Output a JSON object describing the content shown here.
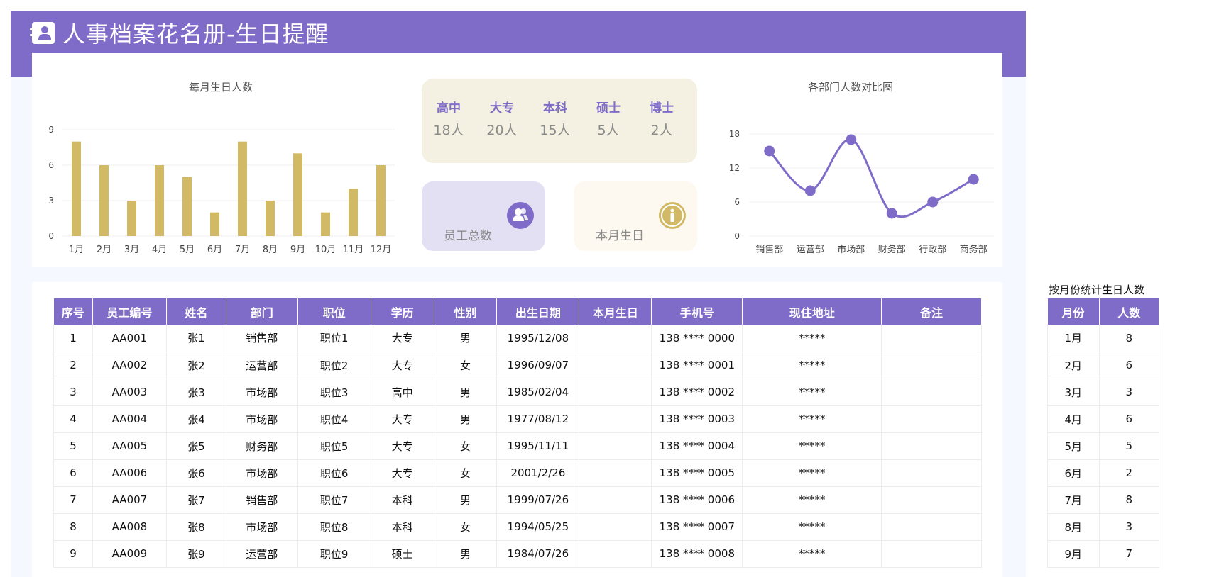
{
  "header": {
    "title": "人事档案花名册-生日提醒"
  },
  "monthly_chart": {
    "title": "每月生日人数",
    "chart_data": {
      "type": "bar",
      "categories": [
        "1月",
        "2月",
        "3月",
        "4月",
        "5月",
        "6月",
        "7月",
        "8月",
        "9月",
        "10月",
        "11月",
        "12月"
      ],
      "values": [
        8,
        6,
        3,
        6,
        5,
        2,
        8,
        3,
        7,
        2,
        4,
        6
      ],
      "ylim": [
        0,
        9
      ],
      "yticks": [
        0,
        3,
        6,
        9
      ],
      "color": "#d2b965"
    }
  },
  "education": [
    {
      "label": "高中",
      "value": "18人"
    },
    {
      "label": "大专",
      "value": "20人"
    },
    {
      "label": "本科",
      "value": "15人"
    },
    {
      "label": "硕士",
      "value": "5人"
    },
    {
      "label": "博士",
      "value": "2人"
    }
  ],
  "kpis": {
    "total_label": "员工总数",
    "month_birthday_label": "本月生日",
    "total_icon": "users-icon",
    "month_icon": "info-icon"
  },
  "dept_chart": {
    "title": "各部门人数对比图",
    "chart_data": {
      "type": "line",
      "categories": [
        "销售部",
        "运营部",
        "市场部",
        "财务部",
        "行政部",
        "商务部"
      ],
      "values": [
        15,
        8,
        17,
        4,
        6,
        10
      ],
      "ylim": [
        0,
        18
      ],
      "yticks": [
        0,
        6,
        12,
        18
      ],
      "color": "#7f6cc8"
    }
  },
  "table": {
    "headers": [
      "序号",
      "员工编号",
      "姓名",
      "部门",
      "职位",
      "学历",
      "性别",
      "出生日期",
      "本月生日",
      "手机号",
      "现住地址",
      "备注"
    ],
    "rows": [
      [
        "1",
        "AA001",
        "张1",
        "销售部",
        "职位1",
        "大专",
        "男",
        "1995/12/08",
        "",
        "138 **** 0000",
        "*****",
        ""
      ],
      [
        "2",
        "AA002",
        "张2",
        "运营部",
        "职位2",
        "大专",
        "女",
        "1996/09/07",
        "",
        "138 **** 0001",
        "*****",
        ""
      ],
      [
        "3",
        "AA003",
        "张3",
        "市场部",
        "职位3",
        "高中",
        "男",
        "1985/02/04",
        "",
        "138 **** 0002",
        "*****",
        ""
      ],
      [
        "4",
        "AA004",
        "张4",
        "市场部",
        "职位4",
        "大专",
        "男",
        "1977/08/12",
        "",
        "138 **** 0003",
        "*****",
        ""
      ],
      [
        "5",
        "AA005",
        "张5",
        "财务部",
        "职位5",
        "大专",
        "女",
        "1995/11/11",
        "",
        "138 **** 0004",
        "*****",
        ""
      ],
      [
        "6",
        "AA006",
        "张6",
        "市场部",
        "职位6",
        "大专",
        "女",
        "2001/2/26",
        "",
        "138 **** 0005",
        "*****",
        ""
      ],
      [
        "7",
        "AA007",
        "张7",
        "销售部",
        "职位7",
        "本科",
        "男",
        "1999/07/26",
        "",
        "138 **** 0006",
        "*****",
        ""
      ],
      [
        "8",
        "AA008",
        "张8",
        "市场部",
        "职位8",
        "本科",
        "女",
        "1994/05/25",
        "",
        "138 **** 0007",
        "*****",
        ""
      ],
      [
        "9",
        "AA009",
        "张9",
        "运营部",
        "职位9",
        "硕士",
        "男",
        "1984/07/26",
        "",
        "138 **** 0008",
        "*****",
        ""
      ]
    ]
  },
  "side_table": {
    "caption": "按月份统计生日人数",
    "headers": [
      "月份",
      "人数"
    ],
    "rows": [
      [
        "1月",
        "8"
      ],
      [
        "2月",
        "6"
      ],
      [
        "3月",
        "3"
      ],
      [
        "4月",
        "6"
      ],
      [
        "5月",
        "5"
      ],
      [
        "6月",
        "2"
      ],
      [
        "7月",
        "8"
      ],
      [
        "8月",
        "3"
      ],
      [
        "9月",
        "7"
      ]
    ]
  },
  "colors": {
    "accent": "#7f6cc8",
    "bar": "#d2b965",
    "panel": "#f5f8fe"
  }
}
